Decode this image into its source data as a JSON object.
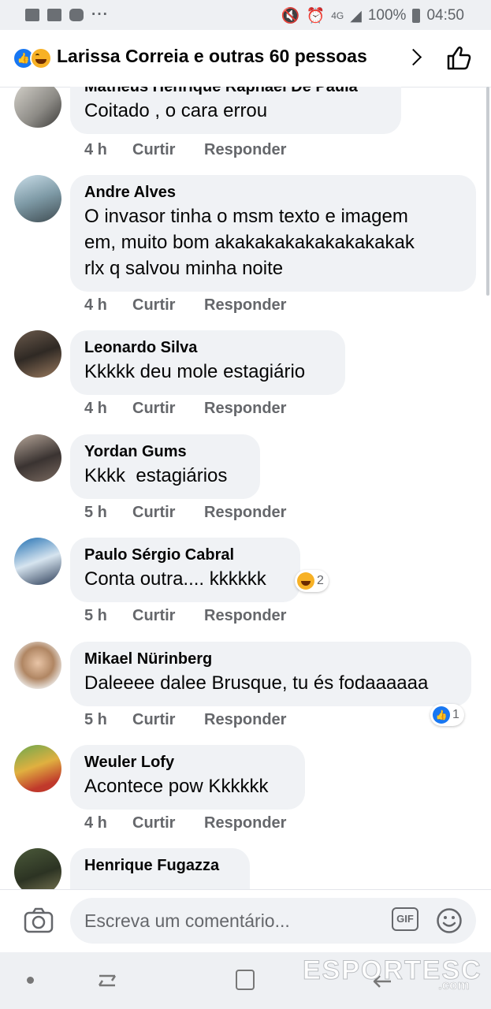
{
  "status_bar": {
    "network": "4G",
    "battery": "100%",
    "time": "04:50"
  },
  "header": {
    "title": "Larissa Correia e outras 60 pessoas"
  },
  "actions": {
    "like": "Curtir",
    "reply": "Responder"
  },
  "comments": [
    {
      "name": "Matheus Henrique Raphael De Paula",
      "text": "Coitado , o cara errou",
      "time": "4 h"
    },
    {
      "name": "Andre Alves",
      "text": "O invasor tinha o msm texto e imagem\nem, muito bom akakakakakakakakakak\nrlx q salvou minha noite",
      "time": "4 h"
    },
    {
      "name": "Leonardo Silva",
      "text": "Kkkkk deu mole estagiário",
      "time": "4 h"
    },
    {
      "name": "Yordan Gums",
      "text": "Kkkk  estagiários",
      "time": "5 h"
    },
    {
      "name": "Paulo Sérgio Cabral",
      "text": "Conta outra.... kkkkkk",
      "time": "5 h",
      "reaction_count": "2"
    },
    {
      "name": "Mikael Nürinberg",
      "text": "Daleeee dalee Brusque, tu és fodaaaaaa",
      "time": "5 h",
      "reaction_count": "1"
    },
    {
      "name": "Weuler Lofy",
      "text": "Acontece pow Kkkkkk",
      "time": "4 h"
    },
    {
      "name": "Henrique Fugazza",
      "text": "",
      "time": ""
    }
  ],
  "composer": {
    "placeholder": "Escreva um comentário...",
    "gif_label": "GIF"
  },
  "watermark": {
    "main": "ESPORTESC",
    "sub": ".com"
  },
  "colors": {
    "accent": "#1877f2",
    "bubble": "#f0f2f5",
    "secondary_text": "#65676b"
  }
}
